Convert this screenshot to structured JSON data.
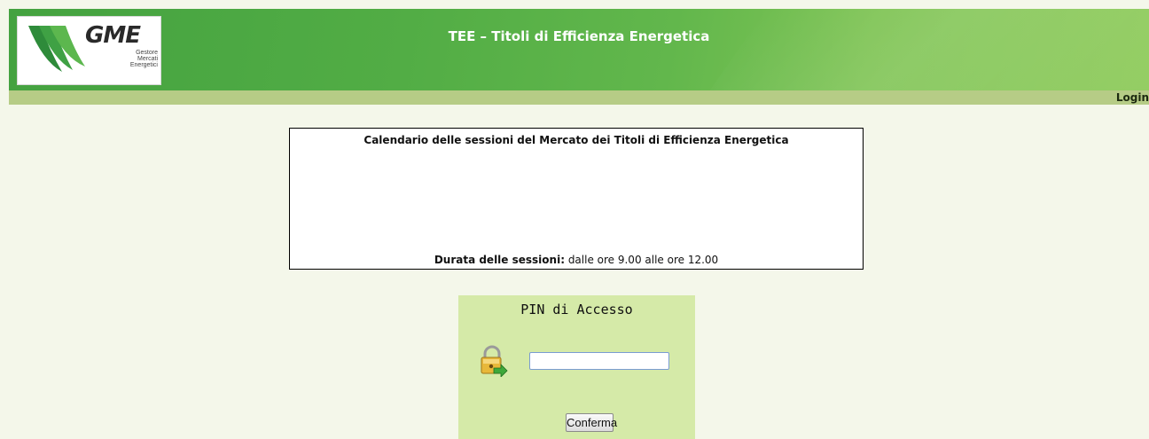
{
  "header": {
    "title": "TEE – Titoli di Efficienza Energetica",
    "logo": {
      "name": "GME",
      "subtitle_lines": [
        "Gestore",
        "Mercati",
        "Energetici"
      ]
    }
  },
  "nav": {
    "login_label": "Login"
  },
  "calendar": {
    "title": "Calendario delle sessioni del Mercato dei Titoli di Efficienza Energetica",
    "duration_label": "Durata delle sessioni:",
    "duration_value": " dalle ore 9.00 alle ore 12.00"
  },
  "pin": {
    "title": "PIN di Accesso",
    "input_value": "",
    "confirm_label": "Conferma"
  },
  "colors": {
    "header_green": "#52ad45",
    "login_bar": "#b6cc86",
    "pin_panel": "#d5eaa8",
    "background": "#f4f7ea"
  }
}
